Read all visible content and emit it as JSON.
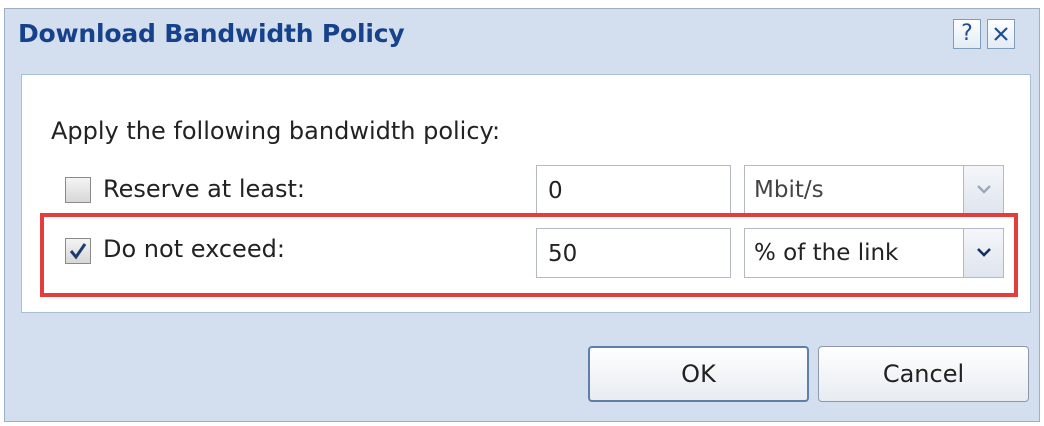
{
  "dialog": {
    "title": "Download Bandwidth Policy",
    "help_label": "?",
    "intro": "Apply the following bandwidth policy:",
    "rows": [
      {
        "label": "Reserve at least:",
        "checked": false,
        "value": "0",
        "unit": "Mbit/s",
        "unit_enabled": false
      },
      {
        "label": "Do not exceed:",
        "checked": true,
        "value": "50",
        "unit": "% of the link",
        "unit_enabled": true
      }
    ],
    "buttons": {
      "ok": "OK",
      "cancel": "Cancel"
    }
  },
  "colors": {
    "title": "#15428b",
    "frame": "#d3dfee",
    "highlight": "#e53c3c"
  },
  "icons": {
    "help": "help-icon",
    "close": "close-icon",
    "check": "checkmark-icon",
    "dropdown": "chevron-down-icon"
  }
}
